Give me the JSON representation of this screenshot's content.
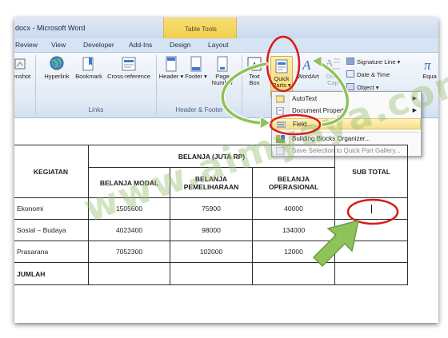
{
  "window": {
    "title": "docx - Microsoft Word",
    "context_group_title": "Table Tools"
  },
  "tabs": [
    "Review",
    "View",
    "Developer",
    "Add-Ins",
    "Design",
    "Layout"
  ],
  "ribbon": {
    "buttons": {
      "snapshot": "enshot",
      "hyperlink": "Hyperlink",
      "bookmark": "Bookmark",
      "cross_reference": "Cross-reference",
      "header": "Header",
      "footer": "Footer",
      "page_number": "Page Number",
      "text_box": "Text Box",
      "quick_parts": "Quick Parts",
      "wordart": "WordArt",
      "drop_cap": "Drop Cap",
      "signature_line": "Signature Line",
      "date_time": "Date & Time",
      "object": "Object",
      "equation": "Equa"
    },
    "groups": {
      "links": "Links",
      "header_footer": "Header & Footer"
    }
  },
  "quick_parts_menu": {
    "items": [
      {
        "label": "AutoText",
        "submenu": true,
        "disabled": false
      },
      {
        "label": "Document Property",
        "submenu": true,
        "disabled": false
      },
      {
        "label": "Field...",
        "submenu": false,
        "disabled": false,
        "highlighted": true
      },
      {
        "label": "Building Blocks Organizer...",
        "submenu": false,
        "disabled": false
      },
      {
        "label": "Save Selection to Quick Part Gallery...",
        "submenu": false,
        "disabled": true
      }
    ]
  },
  "table": {
    "header_kegiatan": "KEGIATAN",
    "header_group": "BELANJA (JUTA RP)",
    "col_modal": "BELANJA MODAL",
    "col_pemeliharaan": "BELANJA PEMELIHARAAN",
    "col_operasional": "BELANJA OPERASIONAL",
    "col_subtotal": "SUB TOTAL",
    "rows": [
      {
        "kegiatan": "Ekonomi",
        "modal": "1505600",
        "pemeliharaan": "75900",
        "operasional": "40000",
        "subtotal": ""
      },
      {
        "kegiatan": "Sosial – Budaya",
        "modal": "4023400",
        "pemeliharaan": "98000",
        "operasional": "134000",
        "subtotal": ""
      },
      {
        "kegiatan": "Prasarana",
        "modal": "7052300",
        "pemeliharaan": "102000",
        "operasional": "12000",
        "subtotal": ""
      },
      {
        "kegiatan": "JUMLAH",
        "modal": "",
        "pemeliharaan": "",
        "operasional": "",
        "subtotal": ""
      }
    ]
  },
  "watermark": "www.aimyaya.com",
  "colors": {
    "annotation_red": "#d81b1b",
    "arrow_green": "#8ec25a",
    "menu_highlight": "#f9df86",
    "context_tab_yellow": "#f1cf4e"
  }
}
